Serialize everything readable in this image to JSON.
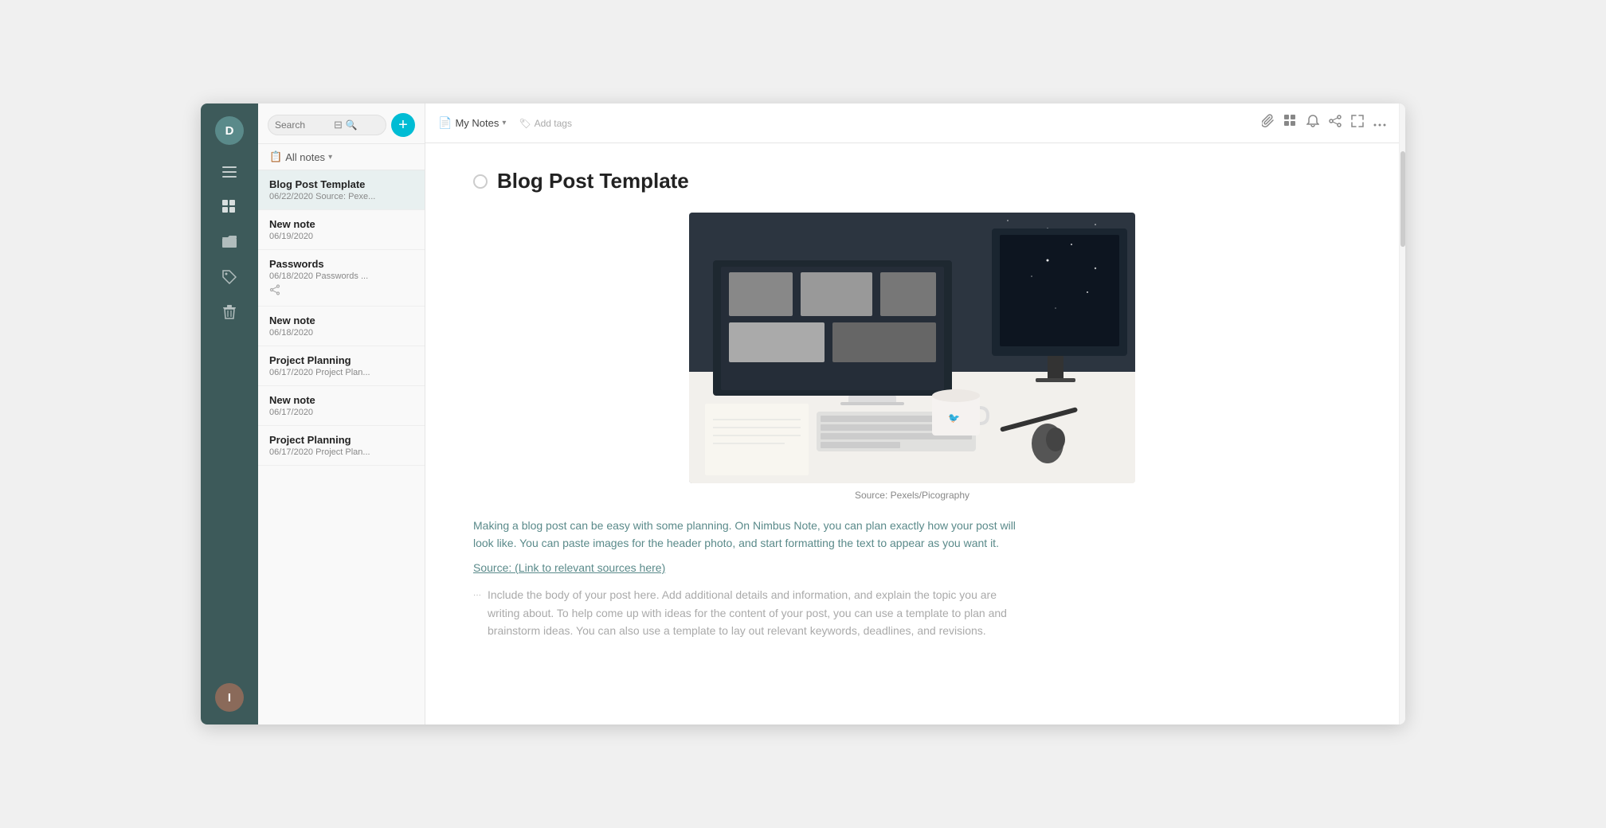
{
  "app": {
    "title": "Nimbus Note"
  },
  "sidebar": {
    "top_avatar_initial": "D",
    "bottom_avatar_initial": "I",
    "nav_icons": [
      {
        "name": "menu-icon",
        "symbol": "☰"
      },
      {
        "name": "dashboard-icon",
        "symbol": "⊞"
      },
      {
        "name": "folder-icon",
        "symbol": "📁"
      },
      {
        "name": "tag-icon",
        "symbol": "🏷"
      },
      {
        "name": "trash-icon",
        "symbol": "🗑"
      }
    ]
  },
  "notes_panel": {
    "search_placeholder": "Search",
    "all_notes_label": "All notes",
    "add_button_label": "+",
    "notes": [
      {
        "title": "Blog Post Template",
        "meta": "06/22/2020 Source: Pexe...",
        "active": true,
        "share": false
      },
      {
        "title": "New note",
        "meta": "06/19/2020",
        "active": false,
        "share": false
      },
      {
        "title": "Passwords",
        "meta": "06/18/2020 Passwords ...",
        "active": false,
        "share": true
      },
      {
        "title": "New note",
        "meta": "06/18/2020",
        "active": false,
        "share": false
      },
      {
        "title": "Project Planning",
        "meta": "06/17/2020 Project Plan...",
        "active": false,
        "share": false
      },
      {
        "title": "New note",
        "meta": "06/17/2020",
        "active": false,
        "share": false
      },
      {
        "title": "Project Planning",
        "meta": "06/17/2020 Project Plan...",
        "active": false,
        "share": false
      }
    ]
  },
  "toolbar": {
    "breadcrumb_icon": "📄",
    "notebook_label": "My Notes",
    "breadcrumb_chevron": "▾",
    "tag_icon": "🏷",
    "add_tags_label": "Add tags",
    "icons": {
      "attach": "📎",
      "grid": "⊞",
      "bell": "🔔",
      "share": "⬆",
      "expand": "⤢",
      "more": "…"
    }
  },
  "note": {
    "title": "Blog Post Template",
    "image_caption": "Source: Pexels/Picography",
    "intro_text": "Making a blog post can be easy with some planning. On Nimbus Note, you can plan exactly how your post will look like. You can paste images for the header photo, and start formatting the text to appear as you want it.",
    "source_link_label": "Source: (Link to relevant sources here)",
    "body_text": "Include the body of your post here. Add additional details and information, and explain the topic you are writing about. To help come up with ideas for the content of your post, you can use a template to plan and brainstorm ideas. You can also use a template to lay out relevant keywords, deadlines, and revisions."
  }
}
